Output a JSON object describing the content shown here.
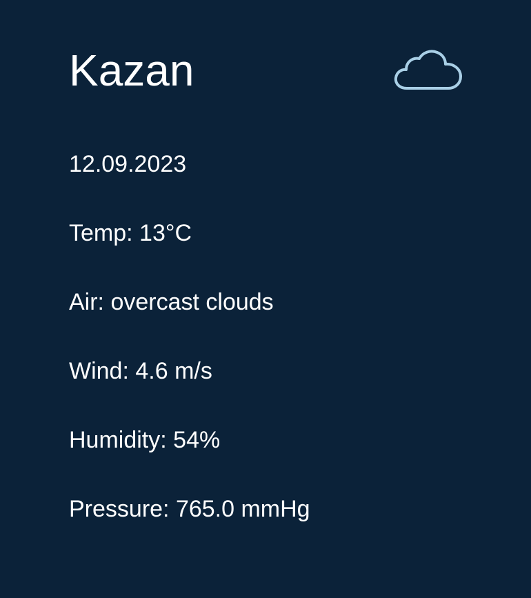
{
  "weather": {
    "city": "Kazan",
    "icon": "cloud-icon",
    "icon_color": "#a9cfe6",
    "date": "12.09.2023",
    "temp": {
      "label": "Temp:",
      "value": "13°C"
    },
    "air": {
      "label": "Air:",
      "value": "overcast clouds"
    },
    "wind": {
      "label": "Wind:",
      "value": "4.6 m/s"
    },
    "humidity": {
      "label": "Humidity:",
      "value": "54%"
    },
    "pressure": {
      "label": "Pressure:",
      "value": "765.0 mmHg"
    }
  },
  "colors": {
    "background": "#0b2239",
    "text": "#ffffff"
  }
}
